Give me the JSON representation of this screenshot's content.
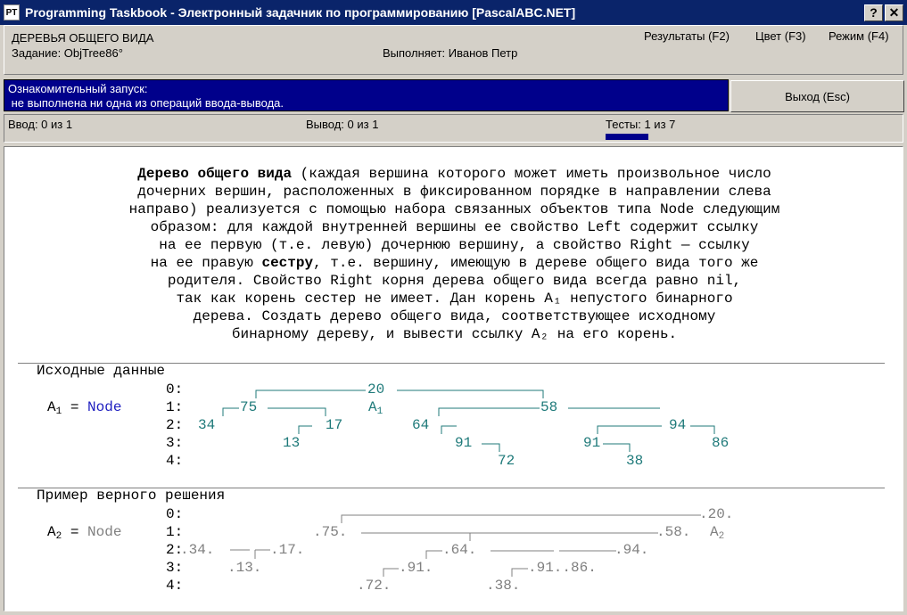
{
  "window": {
    "title": "Programming Taskbook - Электронный задачник по программированию [PascalABC.NET]",
    "icon_text": "PT",
    "help_button": "?",
    "close_button": "✕"
  },
  "header": {
    "group": "ДЕРЕВЬЯ ОБЩЕГО ВИДА",
    "task": "Задание: ObjTree86°",
    "student": "Выполняет: Иванов Петр",
    "menu": [
      "Результаты (F2)",
      "Цвет (F3)",
      "Режим (F4)"
    ]
  },
  "info": {
    "line1": "Ознакомительный запуск:",
    "line2": " не выполнена ни одна из операций ввода-вывода."
  },
  "exit_button": "Выход (Esc)",
  "status": {
    "input": "Ввод: 0 из 1",
    "output": "Вывод: 0 из 1",
    "tests": "Тесты: 1 из 7"
  },
  "task_text": {
    "l1_bold": "Дерево общего вида",
    "l1_rest": " (каждая вершина которого может иметь произвольное число",
    "l2": "дочерних вершин, расположенных в фиксированном порядке в направлении слева",
    "l3": "направо) реализуется с помощью набора связанных объектов типа Node следующим",
    "l4": "образом: для каждой внутренней вершины ее свойство Left содержит ссылку",
    "l5": "на ее первую (т.е. левую) дочернюю вершину, а свойство Right — ссылку",
    "l6_pre": "на ее правую ",
    "l6_bold": "сестру",
    "l6_post": ", т.е. вершину, имеющую в дереве общего вида того же",
    "l7": "родителя. Свойство Right корня дерева общего вида всегда равно nil,",
    "l8": "так как корень сестер не имеет. Дан корень A₁ непустого бинарного",
    "l9": "дерева. Создать дерево общего вида, соответствующее исходному",
    "l10": "бинарному дереву, и вывести ссылку A₂ на его корень."
  },
  "input_section": {
    "label": "Исходные данные",
    "levels": [
      "0:",
      "1:",
      "2:",
      "3:",
      "4:"
    ],
    "var_prefix": "A",
    "var_sub": "1",
    "var_eq": " = ",
    "var_type": "Node",
    "root_ref": "A",
    "root_ref_sub": "1",
    "nodes": [
      "20",
      "75",
      "58",
      "34",
      "17",
      "64",
      "94",
      "13",
      "91",
      "91",
      "86",
      "72",
      "38"
    ]
  },
  "output_section": {
    "label": "Пример верного решения",
    "levels": [
      "0:",
      "1:",
      "2:",
      "3:",
      "4:"
    ],
    "var_prefix": "A",
    "var_sub": "2",
    "var_eq": " = ",
    "var_type": "Node",
    "root_ref": "A",
    "root_ref_sub": "2",
    "nodes": [
      ".20.",
      ".75.",
      ".58.",
      ".34.",
      ".17.",
      ".64.",
      ".94.",
      ".13.",
      ".91.",
      ".91..86.",
      ".72.",
      ".38."
    ]
  },
  "colors": {
    "titlebar": "#0a246a",
    "info_bg": "#00008b",
    "node_teal": "#1f7a7a",
    "node_type_blue": "#2020c0",
    "solution_gray": "#808080"
  }
}
